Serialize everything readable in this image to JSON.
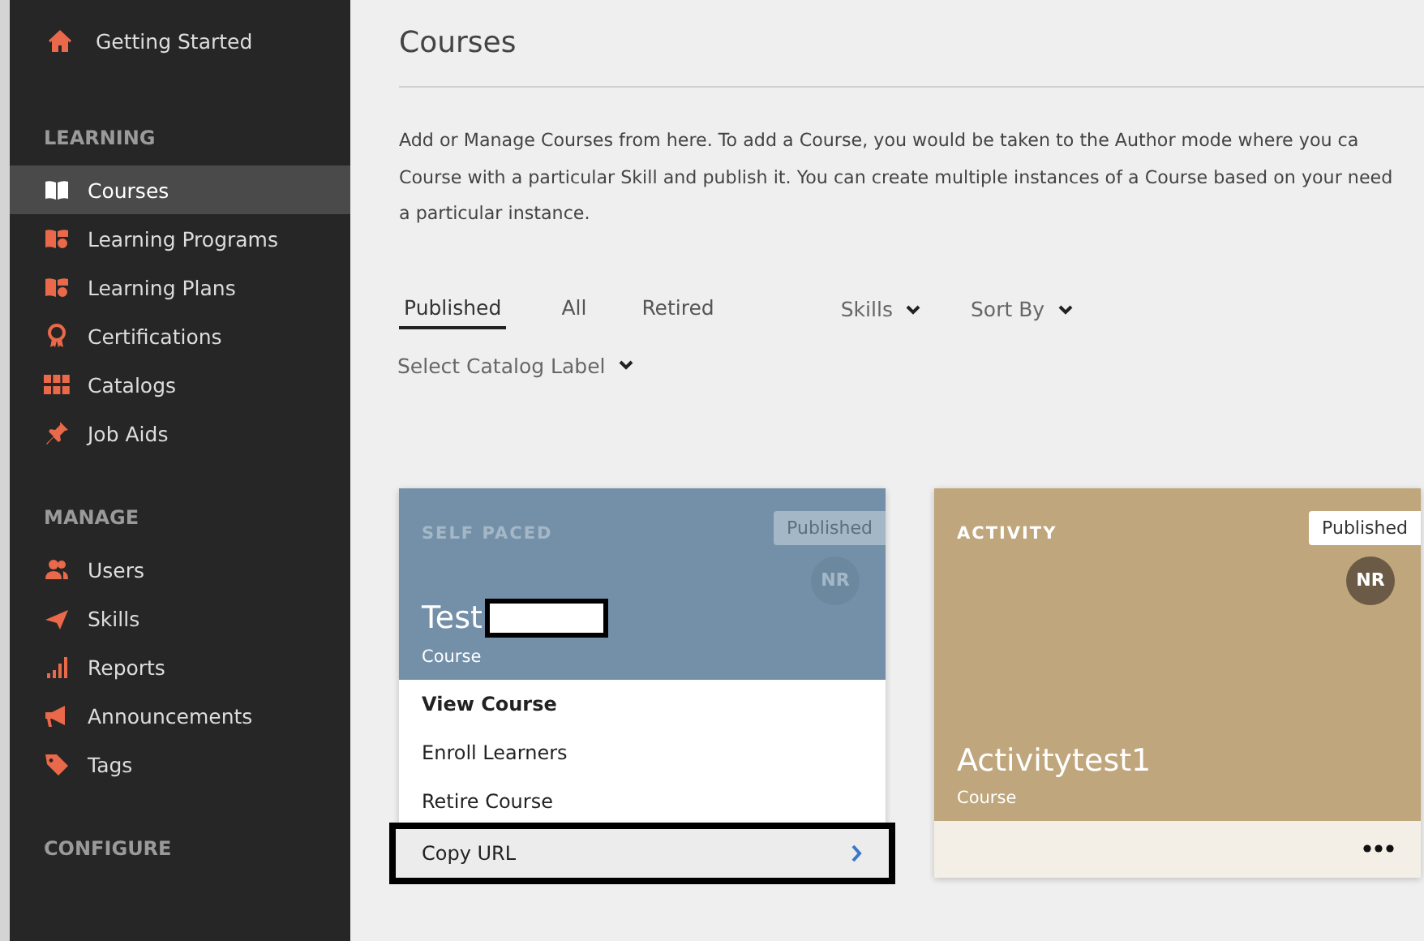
{
  "sidebar": {
    "top_item": {
      "label": "Getting Started",
      "selected": false
    },
    "sections": [
      {
        "heading": "LEARNING",
        "items": [
          {
            "label": "Courses",
            "selected": true
          },
          {
            "label": "Learning Programs",
            "selected": false
          },
          {
            "label": "Learning Plans",
            "selected": false
          },
          {
            "label": "Certifications",
            "selected": false
          },
          {
            "label": "Catalogs",
            "selected": false
          },
          {
            "label": "Job Aids",
            "selected": false
          }
        ]
      },
      {
        "heading": "MANAGE",
        "items": [
          {
            "label": "Users",
            "selected": false
          },
          {
            "label": "Skills",
            "selected": false
          },
          {
            "label": "Reports",
            "selected": false
          },
          {
            "label": "Announcements",
            "selected": false
          },
          {
            "label": "Tags",
            "selected": false
          }
        ]
      },
      {
        "heading": "CONFIGURE"
      }
    ]
  },
  "page": {
    "title": "Courses",
    "description": [
      "Add or Manage Courses from here. To add a Course, you would be taken to the Author mode where you ca",
      "Course with a particular Skill and publish it. You can create multiple instances of a Course based on your need",
      "a particular instance."
    ],
    "tabs": [
      {
        "label": "Published",
        "selected": true
      },
      {
        "label": "All",
        "selected": false
      },
      {
        "label": "Retired",
        "selected": false
      }
    ],
    "filters": [
      "Skills",
      "Sort By"
    ],
    "catalog_filter": "Select Catalog Label"
  },
  "cards": [
    {
      "type": "SELF PACED",
      "title": "Test",
      "subtitle": "Course",
      "status": "Published",
      "initials": "NR",
      "color": "#7390a8",
      "redacted": true,
      "menu": [
        {
          "label": "View Course",
          "emphasis": true,
          "highlighted": false
        },
        {
          "label": "Enroll Learners",
          "emphasis": false,
          "highlighted": false
        },
        {
          "label": "Retire Course",
          "emphasis": false,
          "highlighted": false
        },
        {
          "label": "Copy URL",
          "emphasis": false,
          "highlighted": true
        }
      ]
    },
    {
      "type": "ACTIVITY",
      "title": "Activitytest1",
      "subtitle": "Course",
      "status": "Published",
      "initials": "NR",
      "color": "#bfa67c",
      "redacted": false
    }
  ]
}
